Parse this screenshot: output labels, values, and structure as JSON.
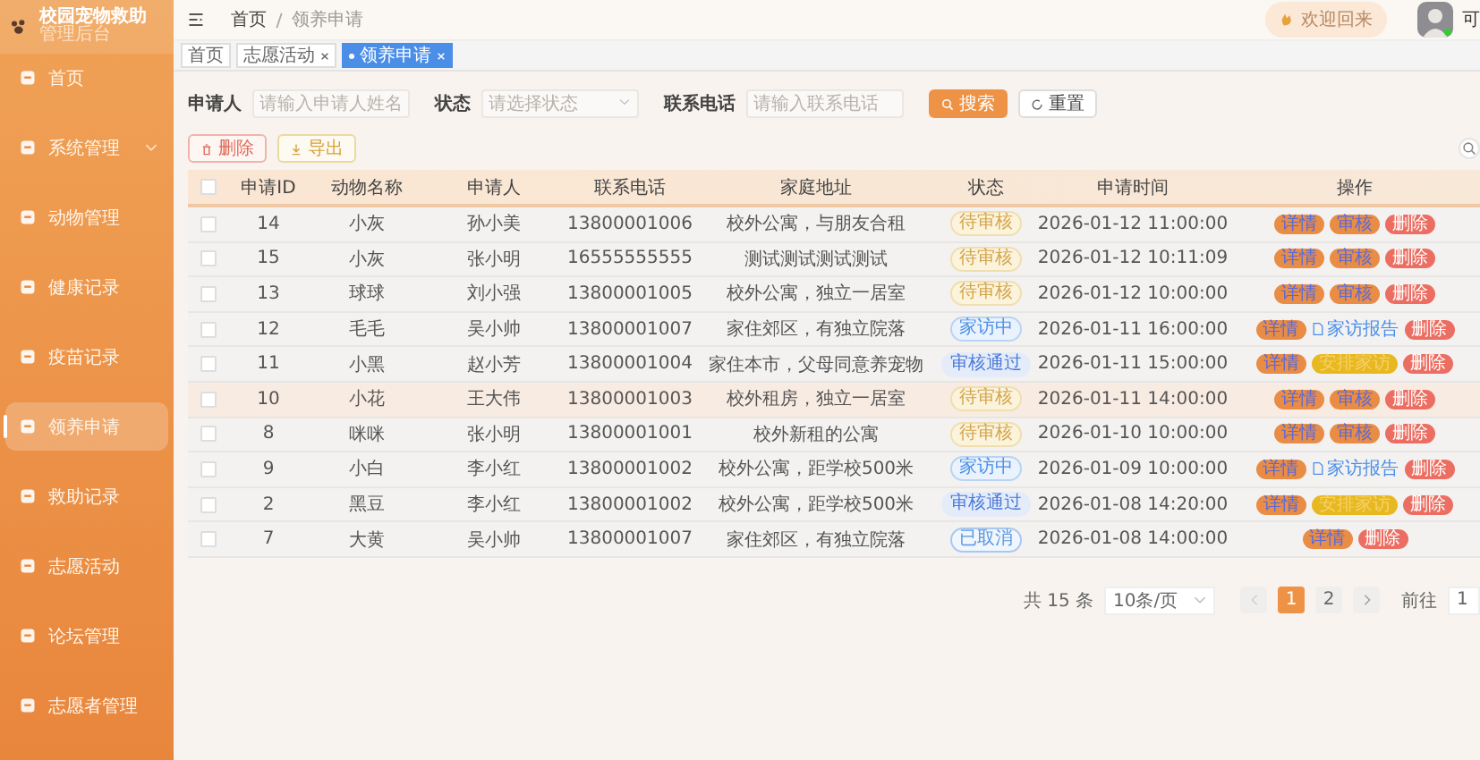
{
  "sidebar": {
    "title": "校园宠物救助",
    "subtitle": "管理后台",
    "items": [
      {
        "label": "首页",
        "selected": false
      },
      {
        "label": "系统管理",
        "selected": false,
        "expandable": true
      },
      {
        "label": "动物管理",
        "selected": false
      },
      {
        "label": "健康记录",
        "selected": false
      },
      {
        "label": "疫苗记录",
        "selected": false
      },
      {
        "label": "领养申请",
        "selected": true
      },
      {
        "label": "救助记录",
        "selected": false
      },
      {
        "label": "志愿活动",
        "selected": false
      },
      {
        "label": "论坛管理",
        "selected": false
      },
      {
        "label": "志愿者管理",
        "selected": false
      }
    ]
  },
  "header": {
    "breadcrumb": [
      "首页",
      "领养申请"
    ],
    "welcome": "欢迎回来",
    "user_name": "可"
  },
  "tabs": [
    {
      "label": "首页",
      "selected": false
    },
    {
      "label": "志愿活动",
      "closable": true,
      "selected": false
    },
    {
      "label": "领养申请",
      "closable": true,
      "selected": true
    }
  ],
  "filters": [
    {
      "label": "申请人",
      "placeholder": "请输入申请人姓名",
      "kind": "input"
    },
    {
      "label": "状态",
      "placeholder": "请选择状态",
      "kind": "select"
    },
    {
      "label": "联系电话",
      "placeholder": "请输入联系电话",
      "kind": "input"
    }
  ],
  "search_button": "搜索",
  "reset_button": "重置",
  "delete_button": "删除",
  "export_button": "导出",
  "table": {
    "select_all_checked": false,
    "columns": [
      "申请ID",
      "动物名称",
      "申请人",
      "联系电话",
      "家庭地址",
      "状态",
      "申请时间",
      "操作"
    ],
    "rows": [
      {
        "id": "14",
        "animal": "小灰",
        "applicant": "孙小美",
        "phone": "13800001006",
        "address": "校外公寓，与朋友合租",
        "status": {
          "label": "待审核",
          "kind": "pending"
        },
        "time": "2026-01-12 11:00:00",
        "highlighted": false,
        "actions": [
          {
            "kind": "detail",
            "label": "详情"
          },
          {
            "kind": "review",
            "label": "审核"
          },
          {
            "kind": "delete",
            "label": "删除"
          }
        ]
      },
      {
        "id": "15",
        "animal": "小灰",
        "applicant": "张小明",
        "phone": "16555555555",
        "address": "测试测试测试测试",
        "status": {
          "label": "待审核",
          "kind": "pending"
        },
        "time": "2026-01-12 10:11:09",
        "highlighted": false,
        "actions": [
          {
            "kind": "detail",
            "label": "详情"
          },
          {
            "kind": "review",
            "label": "审核"
          },
          {
            "kind": "delete",
            "label": "删除"
          }
        ]
      },
      {
        "id": "13",
        "animal": "球球",
        "applicant": "刘小强",
        "phone": "13800001005",
        "address": "校外公寓，独立一居室",
        "status": {
          "label": "待审核",
          "kind": "pending"
        },
        "time": "2026-01-12 10:00:00",
        "highlighted": false,
        "actions": [
          {
            "kind": "detail",
            "label": "详情"
          },
          {
            "kind": "review",
            "label": "审核"
          },
          {
            "kind": "delete",
            "label": "删除"
          }
        ]
      },
      {
        "id": "12",
        "animal": "毛毛",
        "applicant": "吴小帅",
        "phone": "13800001007",
        "address": "家住郊区，有独立院落",
        "status": {
          "label": "家访中",
          "kind": "visiting"
        },
        "time": "2026-01-11 16:00:00",
        "highlighted": false,
        "actions": [
          {
            "kind": "detail",
            "label": "详情"
          },
          {
            "kind": "report",
            "label": "家访报告"
          },
          {
            "kind": "delete",
            "label": "删除"
          }
        ]
      },
      {
        "id": "11",
        "animal": "小黑",
        "applicant": "赵小芳",
        "phone": "13800001004",
        "address": "家住本市，父母同意养宠物",
        "status": {
          "label": "审核通过",
          "kind": "approved"
        },
        "time": "2026-01-11 15:00:00",
        "highlighted": false,
        "actions": [
          {
            "kind": "detail",
            "label": "详情"
          },
          {
            "kind": "visit",
            "label": "安排家访"
          },
          {
            "kind": "delete",
            "label": "删除"
          }
        ]
      },
      {
        "id": "10",
        "animal": "小花",
        "applicant": "王大伟",
        "phone": "13800001003",
        "address": "校外租房，独立一居室",
        "status": {
          "label": "待审核",
          "kind": "pending"
        },
        "time": "2026-01-11 14:00:00",
        "highlighted": true,
        "actions": [
          {
            "kind": "detail",
            "label": "详情"
          },
          {
            "kind": "review",
            "label": "审核"
          },
          {
            "kind": "delete",
            "label": "删除"
          }
        ]
      },
      {
        "id": "8",
        "animal": "咪咪",
        "applicant": "张小明",
        "phone": "13800001001",
        "address": "校外新租的公寓",
        "status": {
          "label": "待审核",
          "kind": "pending"
        },
        "time": "2026-01-10 10:00:00",
        "highlighted": false,
        "actions": [
          {
            "kind": "detail",
            "label": "详情"
          },
          {
            "kind": "review",
            "label": "审核"
          },
          {
            "kind": "delete",
            "label": "删除"
          }
        ]
      },
      {
        "id": "9",
        "animal": "小白",
        "applicant": "李小红",
        "phone": "13800001002",
        "address": "校外公寓，距学校500米",
        "status": {
          "label": "家访中",
          "kind": "visiting"
        },
        "time": "2026-01-09 10:00:00",
        "highlighted": false,
        "actions": [
          {
            "kind": "detail",
            "label": "详情"
          },
          {
            "kind": "report",
            "label": "家访报告"
          },
          {
            "kind": "delete",
            "label": "删除"
          }
        ]
      },
      {
        "id": "2",
        "animal": "黑豆",
        "applicant": "李小红",
        "phone": "13800001002",
        "address": "校外公寓，距学校500米",
        "status": {
          "label": "审核通过",
          "kind": "approved"
        },
        "time": "2026-01-08 14:20:00",
        "highlighted": false,
        "actions": [
          {
            "kind": "detail",
            "label": "详情"
          },
          {
            "kind": "visit",
            "label": "安排家访"
          },
          {
            "kind": "delete",
            "label": "删除"
          }
        ]
      },
      {
        "id": "7",
        "animal": "大黄",
        "applicant": "吴小帅",
        "phone": "13800001007",
        "address": "家住郊区，有独立院落",
        "status": {
          "label": "已取消",
          "kind": "cancelled"
        },
        "time": "2026-01-08 14:00:00",
        "highlighted": false,
        "actions": [
          {
            "kind": "detail",
            "label": "详情"
          },
          {
            "kind": "delete",
            "label": "删除"
          }
        ]
      }
    ]
  },
  "pagination": {
    "total": "共 15 条",
    "page_size": "10条/页",
    "pages": [
      {
        "label": "1",
        "selected": true
      },
      {
        "label": "2",
        "selected": false
      }
    ],
    "goto_label": "前往",
    "goto_value": "1"
  }
}
